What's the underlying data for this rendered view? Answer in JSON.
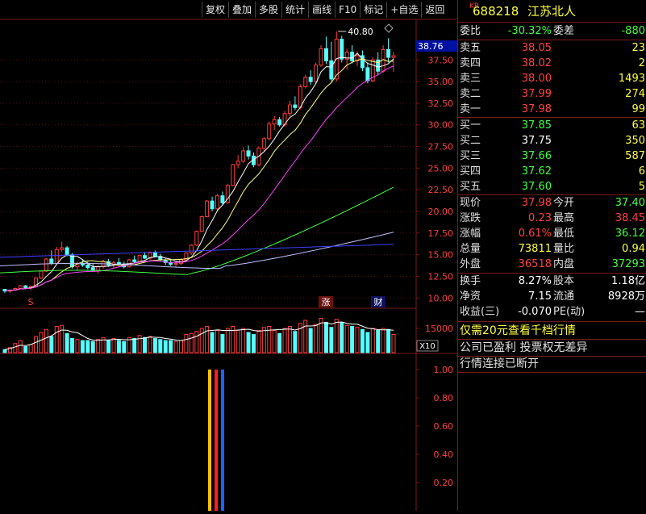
{
  "toolbar": {
    "buttons": [
      "复权",
      "叠加",
      "多股",
      "统计",
      "画线",
      "F10",
      "标记",
      "+自选",
      "返回"
    ]
  },
  "stock": {
    "prefix": "KR",
    "code": "688218",
    "name": "江苏北人"
  },
  "entrust": {
    "ratio_label": "委比",
    "ratio_value": "-30.32%",
    "diff_label": "委差",
    "diff_value": "-880"
  },
  "asks": [
    {
      "label": "卖五",
      "price": "38.05",
      "volume": "23"
    },
    {
      "label": "卖四",
      "price": "38.02",
      "volume": "2"
    },
    {
      "label": "卖三",
      "price": "38.00",
      "volume": "1493"
    },
    {
      "label": "卖二",
      "price": "37.99",
      "volume": "274"
    },
    {
      "label": "卖一",
      "price": "37.98",
      "volume": "99"
    }
  ],
  "bids": [
    {
      "label": "买一",
      "price": "37.85",
      "volume": "63"
    },
    {
      "label": "买二",
      "price": "37.75",
      "volume": "350"
    },
    {
      "label": "买三",
      "price": "37.66",
      "volume": "587"
    },
    {
      "label": "买四",
      "price": "37.62",
      "volume": "6"
    },
    {
      "label": "买五",
      "price": "37.60",
      "volume": "5"
    }
  ],
  "quote": [
    {
      "l1": "现价",
      "v1": "37.98",
      "c1": "red",
      "l2": "今开",
      "v2": "37.40",
      "c2": "grn"
    },
    {
      "l1": "涨跌",
      "v1": "0.23",
      "c1": "red",
      "l2": "最高",
      "v2": "38.45",
      "c2": "red"
    },
    {
      "l1": "涨幅",
      "v1": "0.61%",
      "c1": "red",
      "l2": "最低",
      "v2": "36.12",
      "c2": "grn"
    },
    {
      "l1": "总量",
      "v1": "73811",
      "c1": "yel",
      "l2": "量比",
      "v2": "0.94",
      "c2": "yel"
    },
    {
      "l1": "外盘",
      "v1": "36518",
      "c1": "red",
      "l2": "内盘",
      "v2": "37293",
      "c2": "grn"
    }
  ],
  "fund": [
    {
      "l1": "换手",
      "v1": "8.27%",
      "l2": "股本",
      "v2": "1.18亿"
    },
    {
      "l1": "净资",
      "v1": "7.15",
      "l2": "流通",
      "v2": "8928万"
    },
    {
      "l1": "收益(三)",
      "v1": "-0.070",
      "l2": "PE(动)",
      "v2": "—"
    }
  ],
  "notices": {
    "promo": "仅需20元查看千档行情",
    "profit": "公司已盈利 投票权无差异",
    "status": "行情连接已断开"
  },
  "price_axis": {
    "current_tag": "38.76",
    "ticks": [
      "37.50",
      "35.00",
      "32.50",
      "30.00",
      "27.50",
      "25.00",
      "22.50",
      "20.00",
      "17.50",
      "15.00",
      "12.50",
      "10.00"
    ],
    "high_label": "40.80"
  },
  "markers": {
    "s": "S",
    "zhang": "涨",
    "cai": "财"
  },
  "volume_axis": {
    "tick": "15000",
    "unit": "X10"
  },
  "indicator_axis": {
    "ticks": [
      "1.00",
      "0.80",
      "0.60",
      "0.40",
      "0.20"
    ]
  },
  "colors": {
    "up": "#ff3c3c",
    "down": "#54ffff",
    "ma5": "#ffffff",
    "ma10": "#ffff80",
    "ma20": "#ff40ff",
    "ma60": "#40ff40",
    "ma120": "#c0c0ff",
    "ma250": "#4040ff",
    "frame": "#7a1a1a",
    "bar_yellow": "#ffc000",
    "bar_red": "#ff2020",
    "bar_blue": "#2060ff"
  },
  "chart_data": {
    "type": "candlestick",
    "candles": [
      [
        11.0,
        11.0,
        10.6,
        10.8
      ],
      [
        10.8,
        11.0,
        10.6,
        10.9
      ],
      [
        10.9,
        11.2,
        10.8,
        11.1
      ],
      [
        11.1,
        11.5,
        11.0,
        11.4
      ],
      [
        11.4,
        11.5,
        11.0,
        11.2
      ],
      [
        11.2,
        11.4,
        10.9,
        11.3
      ],
      [
        11.3,
        12.4,
        11.2,
        12.3
      ],
      [
        12.3,
        13.2,
        12.2,
        13.1
      ],
      [
        13.1,
        14.6,
        13.0,
        14.5
      ],
      [
        14.5,
        15.5,
        13.8,
        14.0
      ],
      [
        14.0,
        15.9,
        13.9,
        15.6
      ],
      [
        15.6,
        16.5,
        15.3,
        15.8
      ],
      [
        15.8,
        16.0,
        14.8,
        15.0
      ],
      [
        15.0,
        15.2,
        13.4,
        13.6
      ],
      [
        13.6,
        14.2,
        13.2,
        14.0
      ],
      [
        14.0,
        14.5,
        13.6,
        13.8
      ],
      [
        13.8,
        14.2,
        13.3,
        13.5
      ],
      [
        13.5,
        14.0,
        13.0,
        13.2
      ],
      [
        13.2,
        13.8,
        12.8,
        13.6
      ],
      [
        13.6,
        14.4,
        13.4,
        14.2
      ],
      [
        14.2,
        14.5,
        13.6,
        13.8
      ],
      [
        13.8,
        14.3,
        13.5,
        14.1
      ],
      [
        14.1,
        14.6,
        13.8,
        13.9
      ],
      [
        13.9,
        14.2,
        13.4,
        13.6
      ],
      [
        13.6,
        14.5,
        13.5,
        14.4
      ],
      [
        14.4,
        14.9,
        14.0,
        14.2
      ],
      [
        14.2,
        15.0,
        14.1,
        14.9
      ],
      [
        14.9,
        15.3,
        14.5,
        14.6
      ],
      [
        14.6,
        15.4,
        14.4,
        15.2
      ],
      [
        15.2,
        15.5,
        14.7,
        14.8
      ],
      [
        14.8,
        15.1,
        14.2,
        14.4
      ],
      [
        14.4,
        14.6,
        13.8,
        14.1
      ],
      [
        14.1,
        14.5,
        13.7,
        13.9
      ],
      [
        13.9,
        14.3,
        13.5,
        14.0
      ],
      [
        14.0,
        14.6,
        13.8,
        14.4
      ],
      [
        14.4,
        15.3,
        14.3,
        15.2
      ],
      [
        15.2,
        16.2,
        15.0,
        16.1
      ],
      [
        16.1,
        17.8,
        16.0,
        17.7
      ],
      [
        17.7,
        19.5,
        17.6,
        19.4
      ],
      [
        19.4,
        21.3,
        19.3,
        21.2
      ],
      [
        21.2,
        21.7,
        20.0,
        20.3
      ],
      [
        20.3,
        22.0,
        20.0,
        21.8
      ],
      [
        21.8,
        22.3,
        20.7,
        21.0
      ],
      [
        21.0,
        23.2,
        20.9,
        23.0
      ],
      [
        23.0,
        25.5,
        22.9,
        25.4
      ],
      [
        25.4,
        26.5,
        25.0,
        25.8
      ],
      [
        25.8,
        27.4,
        25.6,
        27.0
      ],
      [
        27.0,
        27.6,
        26.0,
        26.4
      ],
      [
        26.4,
        26.8,
        25.1,
        25.4
      ],
      [
        25.4,
        27.5,
        25.2,
        27.3
      ],
      [
        27.3,
        28.6,
        27.0,
        28.4
      ],
      [
        28.4,
        30.4,
        28.2,
        30.1
      ],
      [
        30.1,
        31.0,
        29.4,
        30.6
      ],
      [
        30.6,
        30.9,
        29.8,
        30.0
      ],
      [
        30.0,
        31.6,
        29.8,
        31.3
      ],
      [
        31.3,
        32.8,
        31.0,
        32.3
      ],
      [
        32.3,
        33.3,
        31.7,
        32.0
      ],
      [
        32.0,
        34.7,
        31.8,
        34.4
      ],
      [
        34.4,
        35.8,
        34.2,
        35.5
      ],
      [
        35.5,
        36.3,
        34.6,
        35.0
      ],
      [
        35.0,
        37.2,
        34.8,
        36.9
      ],
      [
        36.9,
        39.2,
        36.7,
        38.8
      ],
      [
        38.8,
        40.2,
        37.0,
        37.4
      ],
      [
        37.4,
        39.6,
        35.0,
        35.3
      ],
      [
        35.3,
        40.8,
        35.0,
        39.9
      ],
      [
        39.9,
        40.3,
        37.2,
        37.6
      ],
      [
        37.6,
        38.8,
        36.4,
        38.4
      ],
      [
        38.4,
        39.2,
        37.1,
        37.4
      ],
      [
        37.4,
        38.5,
        36.8,
        38.0
      ],
      [
        38.0,
        38.6,
        36.2,
        36.6
      ],
      [
        36.6,
        37.2,
        34.8,
        35.1
      ],
      [
        35.1,
        37.8,
        34.9,
        37.5
      ],
      [
        37.5,
        38.4,
        35.8,
        36.2
      ],
      [
        36.2,
        39.2,
        36.0,
        38.7
      ],
      [
        38.7,
        40.0,
        37.2,
        37.8
      ],
      [
        37.8,
        38.45,
        36.12,
        37.98
      ]
    ],
    "volumes": [
      3,
      5,
      9,
      12,
      6,
      8,
      16,
      20,
      23,
      16,
      26,
      27,
      19,
      14,
      13,
      12,
      12,
      11,
      13,
      15,
      12,
      14,
      12,
      11,
      15,
      14,
      17,
      15,
      16,
      14,
      13,
      12,
      12,
      11,
      12,
      18,
      19,
      21,
      24,
      26,
      20,
      22,
      18,
      24,
      26,
      22,
      24,
      20,
      18,
      22,
      25,
      26,
      22,
      19,
      24,
      26,
      21,
      29,
      32,
      24,
      28,
      34,
      30,
      25,
      33,
      30,
      27,
      26,
      25,
      23,
      20,
      24,
      22,
      24,
      23,
      18
    ],
    "ylim": [
      9,
      42
    ],
    "vol_max": 36,
    "indicator_bars": [
      1.0,
      1.0,
      1.0
    ]
  }
}
